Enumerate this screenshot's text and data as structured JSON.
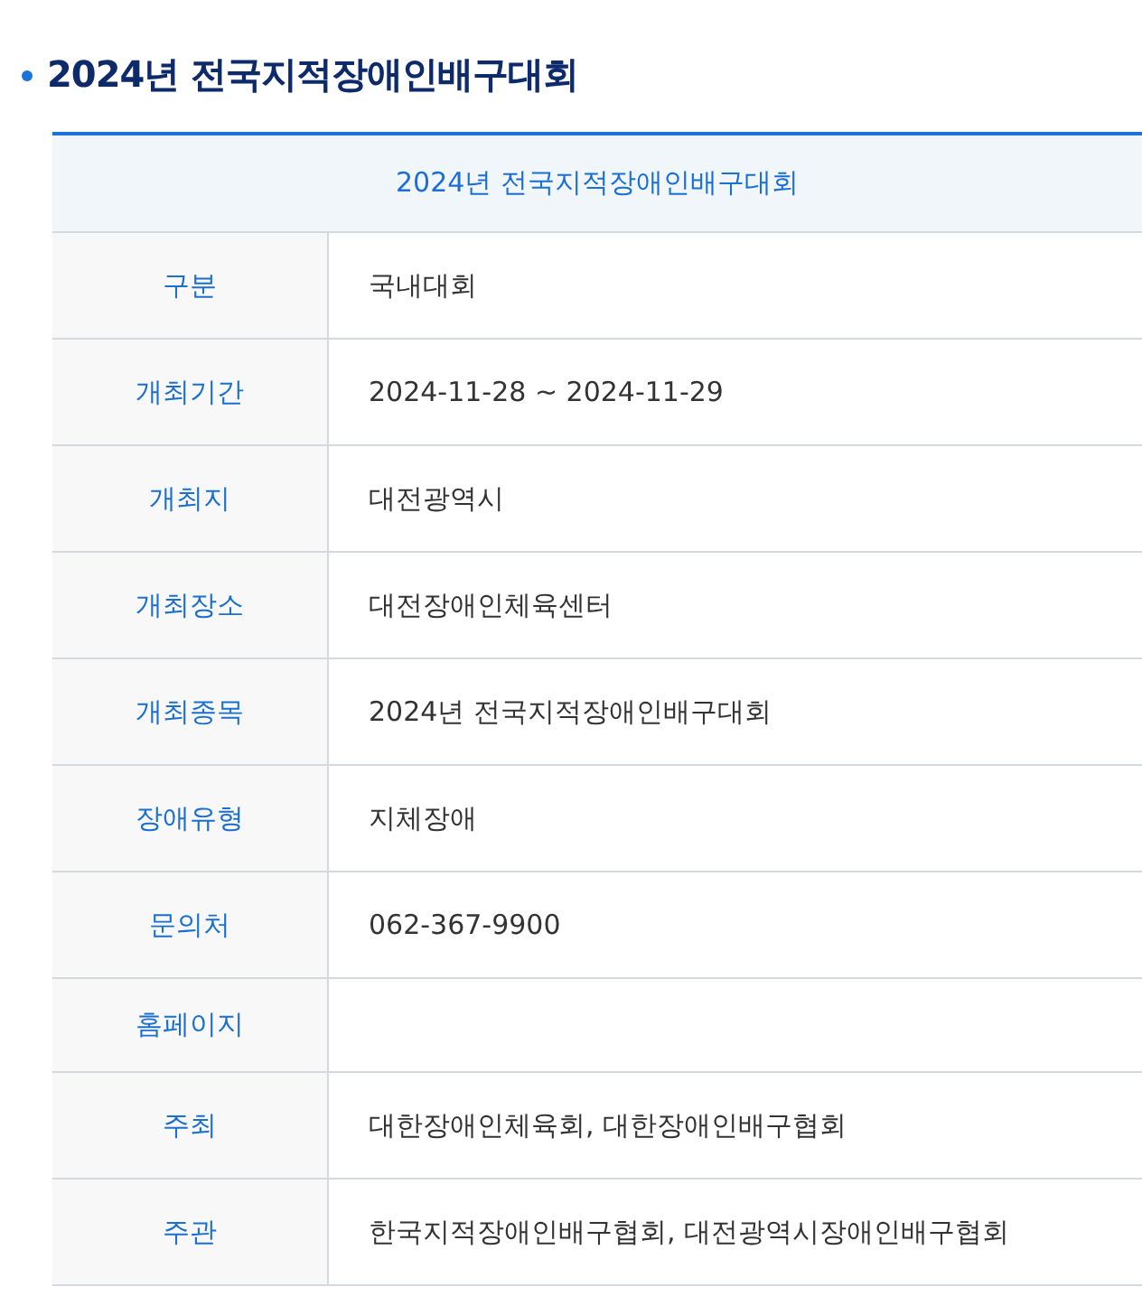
{
  "heading": "2024년 전국지적장애인배구대회",
  "table": {
    "caption": "2024년 전국지적장애인배구대회",
    "rows": [
      {
        "label": "구분",
        "value": "국내대회"
      },
      {
        "label": "개최기간",
        "value": "2024-11-28 ~ 2024-11-29"
      },
      {
        "label": "개최지",
        "value": "대전광역시"
      },
      {
        "label": "개최장소",
        "value": "대전장애인체육센터"
      },
      {
        "label": "개최종목",
        "value": "2024년 전국지적장애인배구대회"
      },
      {
        "label": "장애유형",
        "value": "지체장애"
      },
      {
        "label": "문의처",
        "value": "062-367-9900"
      },
      {
        "label": "홈페이지"
      },
      {
        "label": "주최",
        "value": "대한장애인체육회, 대한장애인배구협회"
      },
      {
        "label": "주관",
        "value": "한국지적장애인배구협회, 대전광역시장애인배구협회"
      }
    ]
  }
}
